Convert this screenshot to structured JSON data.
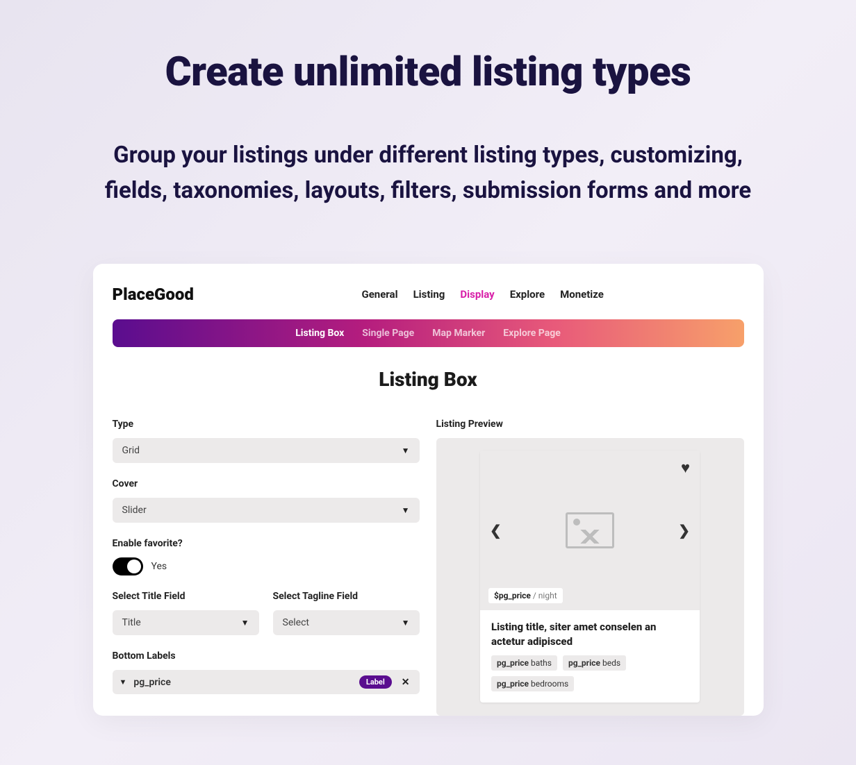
{
  "hero": {
    "title": "Create unlimited listing types",
    "subtitle": "Group your listings under different listing types, customizing, fields, taxonomies, layouts, filters, submission forms and more"
  },
  "brand": "PlaceGood",
  "topnav": {
    "items": [
      "General",
      "Listing",
      "Display",
      "Explore",
      "Monetize"
    ],
    "active": "Display"
  },
  "subtabs": {
    "items": [
      "Listing Box",
      "Single Page",
      "Map Marker",
      "Explore Page"
    ],
    "active": "Listing Box"
  },
  "section_title": "Listing Box",
  "form": {
    "type_label": "Type",
    "type_value": "Grid",
    "cover_label": "Cover",
    "cover_value": "Slider",
    "favorite_label": "Enable favorite?",
    "favorite_value": "Yes",
    "title_field_label": "Select Title Field",
    "title_field_value": "Title",
    "tagline_field_label": "Select Tagline Field",
    "tagline_field_value": "Select",
    "bottom_labels_label": "Bottom Labels",
    "bottom_label_item": "pg_price",
    "bottom_label_badge": "Label"
  },
  "preview": {
    "label": "Listing Preview",
    "price_prefix": "$pg_price",
    "price_suffix": " / night",
    "title": "Listing title, siter amet conselen an actetur adipisced",
    "chips": [
      {
        "b": "pg_price",
        "t": " baths"
      },
      {
        "b": "pg_price",
        "t": " beds"
      },
      {
        "b": "pg_price",
        "t": " bedrooms"
      }
    ]
  }
}
